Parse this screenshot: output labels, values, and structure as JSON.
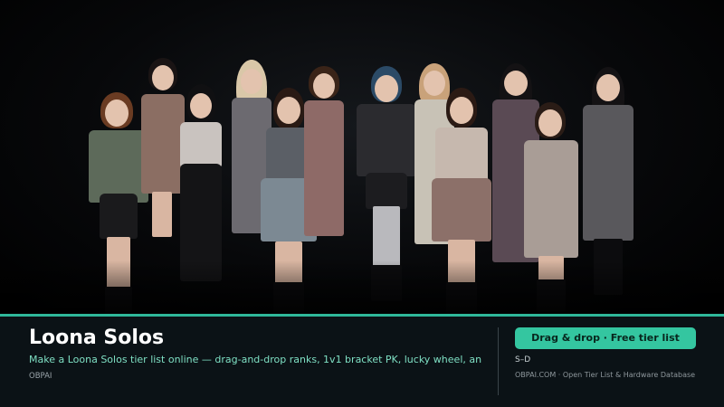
{
  "hero": {
    "image_description_icon": "group-photo",
    "background": "#000000"
  },
  "footer": {
    "title": "Loona Solos",
    "description": "Make a Loona Solos tier list online — drag-and-drop ranks, 1v1 bracket PK, lucky wheel, an",
    "brand_left": "OBPAI",
    "cta_label": "Drag & drop · Free tier list",
    "tier_range": "S–D",
    "brand_right": "OBPAI.COM · Open Tier List & Hardware Database"
  },
  "colors": {
    "accent": "#2fb89a",
    "cta": "#34c6a0",
    "description_text": "#7fe0c4",
    "footer_bg": "#0b1216"
  }
}
